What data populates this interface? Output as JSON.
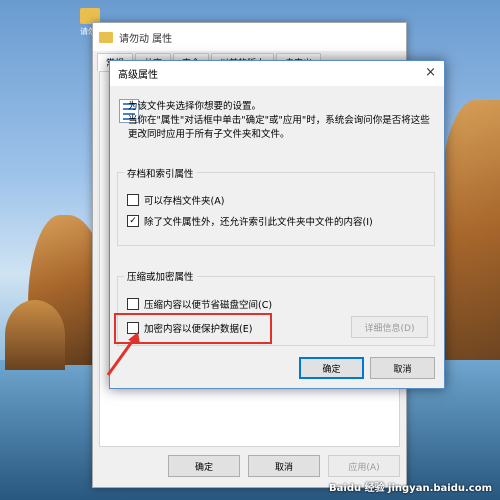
{
  "desktop": {
    "folder_label": "请勿动"
  },
  "properties_window": {
    "title": "请勿动 属性",
    "tabs": [
      "常规",
      "共享",
      "安全",
      "以前的版本",
      "自定义"
    ],
    "buttons": {
      "ok": "确定",
      "cancel": "取消",
      "apply": "应用(A)"
    }
  },
  "advanced_dialog": {
    "title": "高级属性",
    "close_glyph": "×",
    "info_line1": "为该文件夹选择你想要的设置。",
    "info_line2": "当你在\"属性\"对话框中单击\"确定\"或\"应用\"时，系统会询问你是否将这些更改同时应用于所有子文件夹和文件。",
    "archive_group": {
      "title": "存档和索引属性",
      "options": [
        {
          "label": "可以存档文件夹(A)",
          "checked": false
        },
        {
          "label": "除了文件属性外，还允许索引此文件夹中文件的内容(I)",
          "checked": true
        }
      ]
    },
    "compress_group": {
      "title": "压缩或加密属性",
      "options": [
        {
          "label": "压缩内容以便节省磁盘空间(C)",
          "checked": false
        },
        {
          "label": "加密内容以便保护数据(E)",
          "checked": false
        }
      ],
      "details_button": "详细信息(D)"
    },
    "buttons": {
      "ok": "确定",
      "cancel": "取消"
    }
  },
  "annotation": {
    "highlight_color": "#e0322b"
  },
  "watermark": "Baidu 经验 jingyan.baidu.com"
}
